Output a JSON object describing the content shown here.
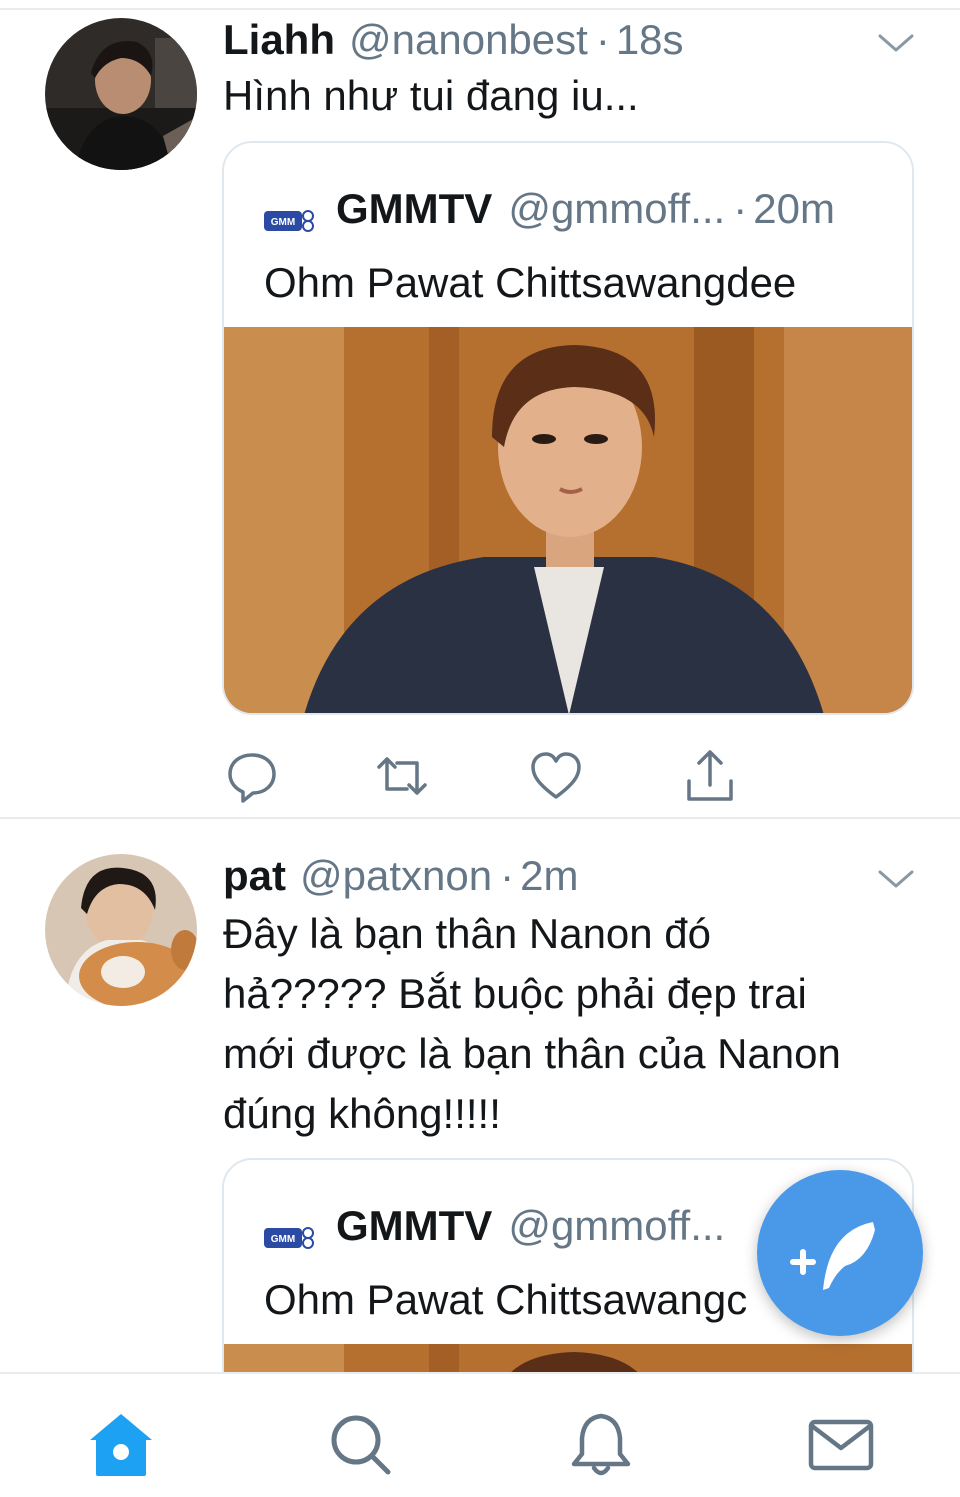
{
  "tweets": [
    {
      "name": "Liahh",
      "handle": "@nanonbest",
      "separator": "·",
      "time": "18s",
      "text": "Hình như tui đang iu...",
      "quote": {
        "name": "GMMTV",
        "handle": "@gmmoff...",
        "separator": "·",
        "time": "20m",
        "text": "Ohm Pawat Chittsawangdee"
      }
    },
    {
      "name": "pat",
      "handle": "@patxnon",
      "separator": "·",
      "time": "2m",
      "text_lines": [
        "Đây là bạn thân Nanon đó",
        "hả????? Bắt buộc phải đẹp trai",
        "mới được là bạn thân của Nanon",
        "đúng không!!!!!"
      ],
      "quote": {
        "name": "GMMTV",
        "handle": "@gmmoff...",
        "text": "Ohm Pawat Chittsawangc"
      }
    }
  ],
  "logo_text": "GMM",
  "icons": {
    "reply": "reply-icon",
    "retweet": "retweet-icon",
    "like": "heart-icon",
    "share": "share-icon",
    "more": "chevron-down-icon",
    "compose": "compose-tweet-icon",
    "home": "home-icon",
    "search": "search-icon",
    "notifications": "bell-icon",
    "messages": "mail-icon"
  },
  "colors": {
    "accent": "#1da1f2",
    "fab": "#4a99e9",
    "secondary_text": "#657786",
    "divider": "#e6ecf0"
  }
}
